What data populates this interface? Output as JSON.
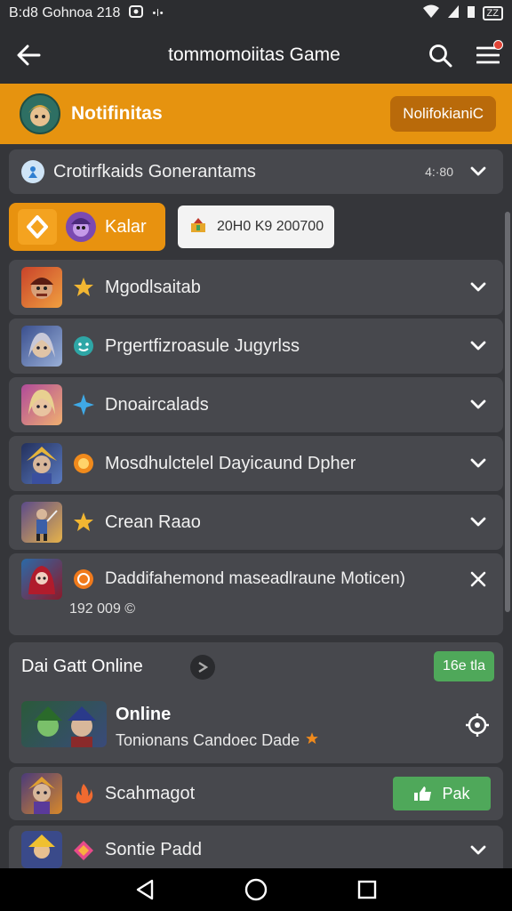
{
  "status_bar": {
    "left_text": "B:d8 Gohnoa 218",
    "dots": "•l•",
    "battery": "ZZ"
  },
  "app_bar": {
    "title": "tommomoiitas Game"
  },
  "notif_banner": {
    "title": "Notifinitas",
    "button": "NolifokianiС"
  },
  "collapse_row": {
    "label": "Crotirfkaids Gonerantams",
    "time": "4:·80"
  },
  "filters": {
    "active": "Kalar",
    "secondary": "20H0 K9 200700"
  },
  "rows": [
    {
      "label": "Mgodlsaitab"
    },
    {
      "label": "Prgertfizroasule Jugyrlss"
    },
    {
      "label": "Dnoaircalads"
    },
    {
      "label": "Mosdhulctelel Dayicaund Dpher"
    },
    {
      "label": "Crean Raao"
    }
  ],
  "expanded_row": {
    "label": "Daddifahemond maseadlraune Moticen)",
    "sub": "192 009 ©"
  },
  "online_section": {
    "title": "Dai Gatt Online",
    "badge": "16e tla",
    "item_title": "Online",
    "item_sub": "Tonionans Candoec Dade"
  },
  "action_row": {
    "label": "Scahmagot",
    "button": "Pak"
  },
  "last_row": {
    "label": "Sontie Padd"
  },
  "colors": {
    "accent": "#e6930f",
    "card": "#47484d",
    "bg": "#35363a",
    "green": "#4fa85a"
  }
}
